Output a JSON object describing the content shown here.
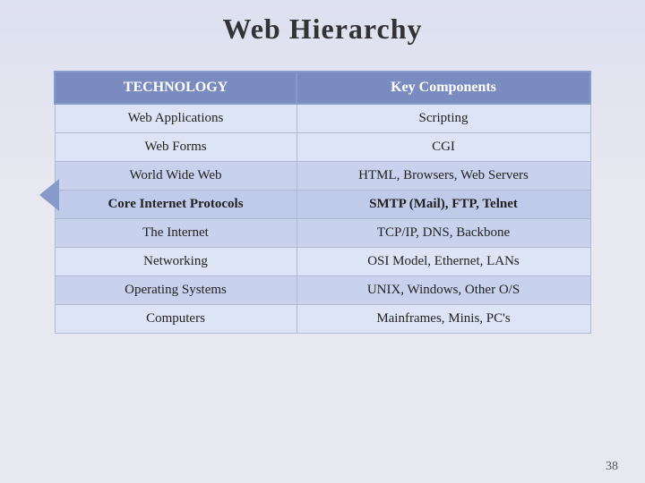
{
  "title": "Web Hierarchy",
  "slide_number": "38",
  "table": {
    "headers": [
      "TECHNOLOGY",
      "Key Components"
    ],
    "rows": [
      {
        "tech": "Web Applications",
        "components": "Scripting",
        "style": "row-light"
      },
      {
        "tech": "Web Forms",
        "components": "CGI",
        "style": "row-light"
      },
      {
        "tech": "World Wide Web",
        "components": "HTML, Browsers, Web Servers",
        "style": "row-medium"
      },
      {
        "tech": "Core Internet Protocols",
        "components": "SMTP (Mail), FTP, Telnet",
        "style": "row-bold"
      },
      {
        "tech": "The Internet",
        "components": "TCP/IP, DNS, Backbone",
        "style": "row-medium"
      },
      {
        "tech": "Networking",
        "components": "OSI Model, Ethernet, LANs",
        "style": "row-light"
      },
      {
        "tech": "Operating Systems",
        "components": "UNIX, Windows, Other O/S",
        "style": "row-medium"
      },
      {
        "tech": "Computers",
        "components": "Mainframes, Minis, PC's",
        "style": "row-light"
      }
    ]
  }
}
